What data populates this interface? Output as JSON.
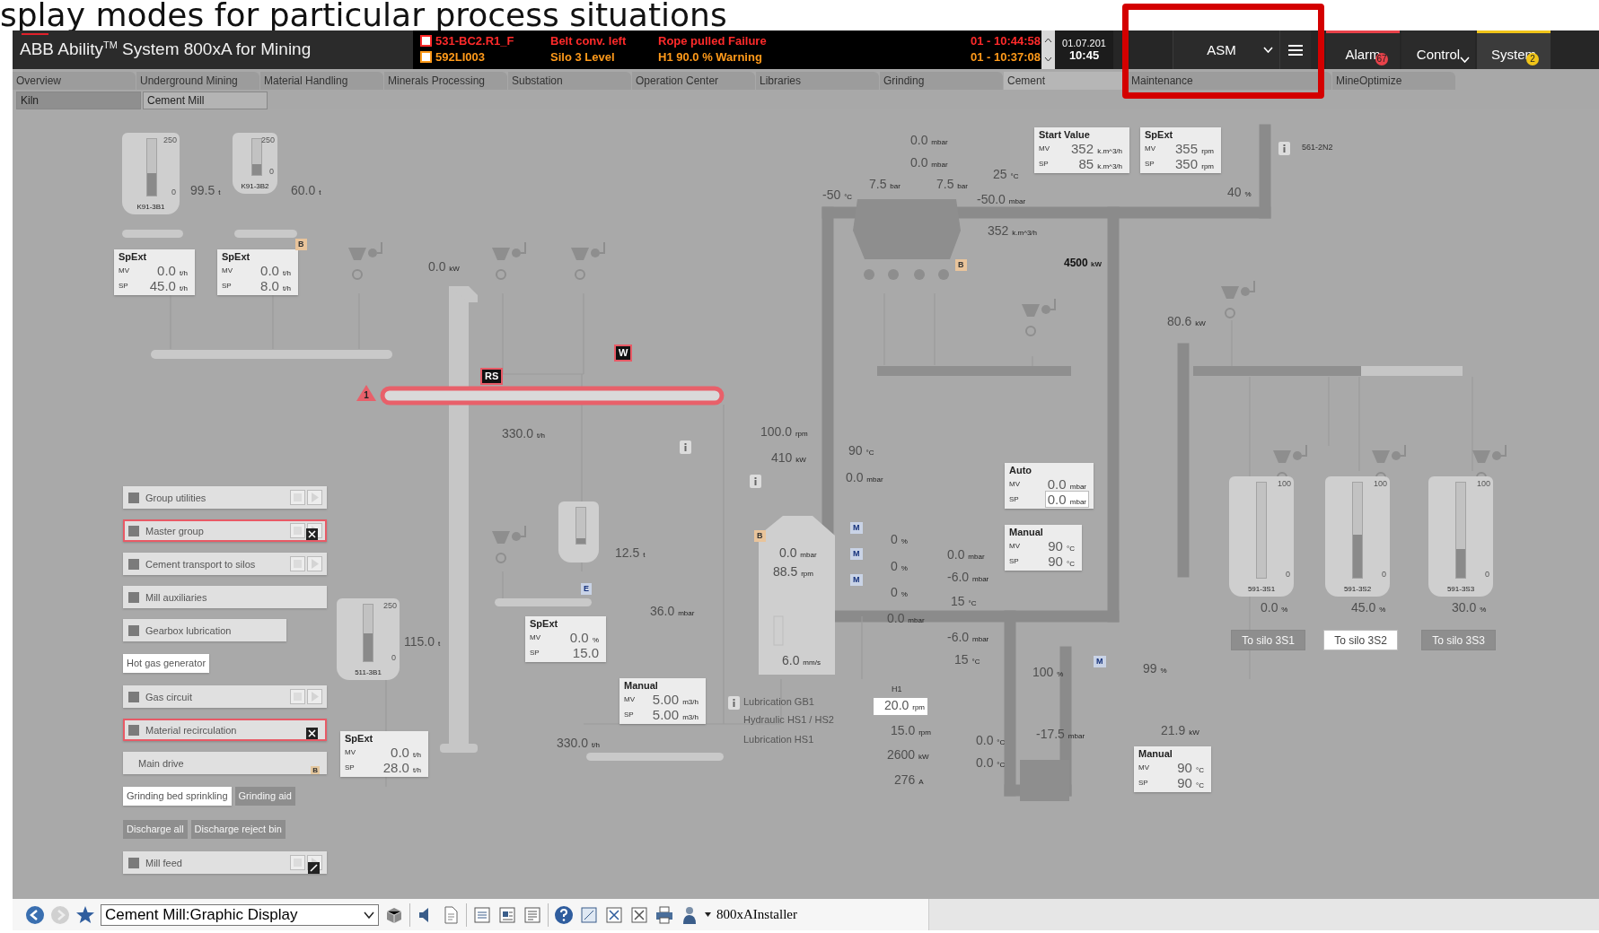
{
  "slide_title": "splay modes for particular process situations",
  "header": {
    "product": "ABB Ability$^{TM}$ System 800xA for Mining",
    "alarms": [
      {
        "tag": "531-BC2.R1_F",
        "object": "Belt conv. left",
        "message": "Rope pulled Failure",
        "time": "01 - 10:44:58",
        "color": "#ff2a2a"
      },
      {
        "tag": "592LI003",
        "object": "Silo 3 Level",
        "message": "H1 90.0 % Warning",
        "time": "01 - 10:37:08",
        "color": "#ff9a1a"
      }
    ],
    "date": "01.07.201",
    "clock": "10:45",
    "mode_selector": "ASM",
    "apps": [
      {
        "label": "Alarm",
        "badge": "67",
        "color": "#e8424a",
        "dropdown": false,
        "selected": false
      },
      {
        "label": "Control",
        "dropdown": true,
        "selected": false
      },
      {
        "label": "System",
        "badge": "2",
        "color": "#f0c419",
        "dropdown": false,
        "selected": true
      }
    ]
  },
  "tabs": [
    {
      "label": "Overview",
      "selected": false
    },
    {
      "label": "Underground Mining",
      "selected": false
    },
    {
      "label": "Material Handling",
      "selected": false
    },
    {
      "label": "Minerals Processing",
      "selected": false
    },
    {
      "label": "Substation",
      "selected": false
    },
    {
      "label": "Operation Center",
      "selected": false
    },
    {
      "label": "Libraries",
      "selected": false
    },
    {
      "label": "Grinding",
      "selected": false
    },
    {
      "label": "Cement",
      "selected": true
    },
    {
      "label": "Maintenance",
      "selected": false
    },
    {
      "label": "MineOptimize",
      "selected": false
    }
  ],
  "subtabs": [
    {
      "label": "Kiln",
      "selected": false
    },
    {
      "label": "Cement Mill",
      "selected": true
    }
  ],
  "faceplates": [
    {
      "title": "SpExt",
      "rows": [
        {
          "label": "MV",
          "value": "0.0",
          "unit": "t/h",
          "editable": false
        },
        {
          "label": "SP",
          "value": "45.0",
          "unit": "t/h",
          "editable": false
        }
      ]
    },
    {
      "title": "SpExt",
      "rows": [
        {
          "label": "MV",
          "value": "0.0",
          "unit": "t/h",
          "editable": false
        },
        {
          "label": "SP",
          "value": "8.0",
          "unit": "t/h",
          "editable": false
        }
      ]
    },
    {
      "title": "Start Value",
      "rows": [
        {
          "label": "MV",
          "value": "352",
          "unit": "k.m^3/h",
          "editable": false
        },
        {
          "label": "SP",
          "value": "85",
          "unit": "k.m^3/h",
          "editable": false
        }
      ]
    },
    {
      "title": "SpExt",
      "rows": [
        {
          "label": "MV",
          "value": "355",
          "unit": "rpm",
          "editable": false
        },
        {
          "label": "SP",
          "value": "350",
          "unit": "rpm",
          "editable": false
        }
      ]
    },
    {
      "title": "Auto",
      "rows": [
        {
          "label": "MV",
          "value": "0.0",
          "unit": "mbar",
          "editable": false
        },
        {
          "label": "SP",
          "value": "0.0",
          "unit": "mbar",
          "editable": true
        }
      ]
    },
    {
      "title": "Manual",
      "rows": [
        {
          "label": "MV",
          "value": "90",
          "unit": "°C",
          "editable": false
        },
        {
          "label": "SP",
          "value": "90",
          "unit": "°C",
          "editable": false
        }
      ]
    },
    {
      "title": "SpExt",
      "rows": [
        {
          "label": "MV",
          "value": "0.0",
          "unit": "%",
          "editable": false
        },
        {
          "label": "SP",
          "value": "15.0",
          "editable": false
        }
      ]
    },
    {
      "title": "Manual",
      "rows": [
        {
          "label": "MV",
          "value": "5.00",
          "unit": "m3/h",
          "editable": false
        },
        {
          "label": "SP",
          "value": "5.00",
          "unit": "m3/h",
          "editable": false
        }
      ]
    },
    {
      "title": "SpExt",
      "rows": [
        {
          "label": "MV",
          "value": "0.0",
          "unit": "t/h",
          "editable": false
        },
        {
          "label": "SP",
          "value": "28.0",
          "unit": "t/h",
          "editable": false
        }
      ]
    },
    {
      "title": "Manual",
      "rows": [
        {
          "label": "MV",
          "value": "90",
          "unit": "°C",
          "editable": false
        },
        {
          "label": "SP",
          "value": "90",
          "unit": "°C",
          "editable": false
        }
      ]
    }
  ],
  "group_panel": {
    "rows": [
      {
        "items": [
          {
            "kind": "group",
            "label": "Group utilities",
            "checkbox": true,
            "controls": true,
            "alarm": false,
            "crossed": false,
            "slashed": false
          }
        ]
      },
      {
        "items": [
          {
            "kind": "group",
            "label": "Master group",
            "checkbox": true,
            "controls": true,
            "alarm": true,
            "crossed": true,
            "slashed": false
          }
        ]
      },
      {
        "items": [
          {
            "kind": "group",
            "label": "Cement transport to silos",
            "checkbox": true,
            "controls": true,
            "alarm": false,
            "crossed": false,
            "slashed": false
          }
        ]
      },
      {
        "items": [
          {
            "kind": "group",
            "label": "Mill auxiliaries",
            "checkbox": true,
            "controls": false,
            "alarm": false,
            "crossed": false,
            "slashed": false
          }
        ]
      },
      {
        "items": [
          {
            "kind": "group",
            "label": "Gearbox lubrication",
            "checkbox": true,
            "controls": false,
            "alarm": false,
            "crossed": false,
            "slashed": false
          }
        ]
      },
      {
        "items": [
          {
            "kind": "link",
            "label": "Hot gas generator",
            "disabled": false
          }
        ]
      },
      {
        "items": [
          {
            "kind": "group",
            "label": "Gas circuit",
            "checkbox": true,
            "controls": true,
            "alarm": false,
            "crossed": false,
            "slashed": false
          }
        ]
      },
      {
        "items": [
          {
            "kind": "group",
            "label": "Material recirculation",
            "checkbox": true,
            "controls": false,
            "alarm": true,
            "crossed": true,
            "slashed": false
          }
        ]
      },
      {
        "items": [
          {
            "kind": "group",
            "label": "Main drive",
            "checkbox": false,
            "controls": false,
            "alarm": false,
            "crossed": false,
            "slashed": false,
            "badge": "B"
          }
        ]
      },
      {
        "items": [
          {
            "kind": "link",
            "label": "Grinding bed sprinkling",
            "disabled": false
          },
          {
            "kind": "link",
            "label": "Grinding aid",
            "disabled": true
          }
        ]
      },
      {
        "items": [
          {
            "kind": "link",
            "label": "Discharge all",
            "disabled": true
          },
          {
            "kind": "link",
            "label": "Discharge reject bin",
            "disabled": true
          }
        ]
      },
      {
        "items": [
          {
            "kind": "group",
            "label": "Mill feed",
            "checkbox": true,
            "controls": true,
            "alarm": false,
            "crossed": false,
            "slashed": true
          }
        ]
      }
    ]
  },
  "silos": [
    {
      "tag": "K91-3B1",
      "scale_max": "250",
      "scale_min": "0",
      "level": 0.4
    },
    {
      "tag": "K91-3B2",
      "scale_max": "250",
      "scale_min": "0",
      "level": 0.3
    },
    {
      "tag": "511-3B1",
      "scale_max": "250",
      "scale_min": "0",
      "level": 0.5
    },
    {
      "level": 0.15
    },
    {
      "tag": "591-3S1",
      "scale_max": "100",
      "scale_min": "0",
      "level": 0.0
    },
    {
      "tag": "591-3S2",
      "scale_max": "100",
      "scale_min": "0",
      "level": 0.45
    },
    {
      "tag": "591-3S3",
      "scale_max": "100",
      "scale_min": "0",
      "level": 0.3
    }
  ],
  "values": [
    {
      "value": "99.5",
      "unit": "t",
      "kind": "faint"
    },
    {
      "value": "60.0",
      "unit": "t",
      "kind": "faint"
    },
    {
      "value": "0.0",
      "unit": "kW",
      "kind": "faint"
    },
    {
      "value": "330.0",
      "unit": "t/h",
      "kind": "faint"
    },
    {
      "value": "100.0",
      "unit": "rpm",
      "kind": "faint"
    },
    {
      "value": "410",
      "unit": "kW",
      "kind": "faint"
    },
    {
      "value": "12.5",
      "unit": "t",
      "kind": "faint"
    },
    {
      "value": "115.0",
      "unit": "t",
      "kind": "faint"
    },
    {
      "value": "36.0",
      "unit": "mbar",
      "kind": "faint"
    },
    {
      "value": "330.0",
      "unit": "t/h",
      "kind": "faint"
    },
    {
      "value": "0.0",
      "unit": "mbar",
      "kind": "faint"
    },
    {
      "value": "0.0",
      "unit": "mbar",
      "kind": "faint"
    },
    {
      "value": "7.5",
      "unit": "bar",
      "kind": "faint"
    },
    {
      "value": "7.5",
      "unit": "bar",
      "kind": "faint"
    },
    {
      "value": "25",
      "unit": "°C",
      "kind": "faint"
    },
    {
      "value": "-50",
      "unit": "°C",
      "kind": "faint"
    },
    {
      "value": "-50.0",
      "unit": "mbar",
      "kind": "faint"
    },
    {
      "value": "352",
      "unit": "k.m^3/h",
      "kind": "faint"
    },
    {
      "value": "40",
      "unit": "%",
      "kind": "faint"
    },
    {
      "value": "4500",
      "unit": "kW",
      "kind": "strong"
    },
    {
      "value": "80.6",
      "unit": "kW",
      "kind": "faint"
    },
    {
      "value": "90",
      "unit": "°C",
      "kind": "faint"
    },
    {
      "value": "0.0",
      "unit": "mbar",
      "kind": "faint"
    },
    {
      "value": "0.0",
      "unit": "mbar",
      "kind": "faint"
    },
    {
      "value": "88.5",
      "unit": "rpm",
      "kind": "faint"
    },
    {
      "value": "0",
      "unit": "%",
      "kind": "faint"
    },
    {
      "value": "0",
      "unit": "%",
      "kind": "faint"
    },
    {
      "value": "0",
      "unit": "%",
      "kind": "faint"
    },
    {
      "value": "0.0",
      "unit": "mbar",
      "kind": "faint"
    },
    {
      "value": "-6.0",
      "unit": "mbar",
      "kind": "faint"
    },
    {
      "value": "15",
      "unit": "°C",
      "kind": "faint"
    },
    {
      "value": "0.0",
      "unit": "mbar",
      "kind": "faint"
    },
    {
      "value": "-6.0",
      "unit": "mbar",
      "kind": "faint"
    },
    {
      "value": "15",
      "unit": "°C",
      "kind": "faint"
    },
    {
      "value": "6.0",
      "unit": "mm/s",
      "kind": "faint"
    },
    {
      "value": "20.0",
      "unit": "rpm",
      "kind": "input"
    },
    {
      "value": "15.0",
      "unit": "rpm",
      "kind": "faint"
    },
    {
      "value": "2600",
      "unit": "kW",
      "kind": "faint"
    },
    {
      "value": "276",
      "unit": "A",
      "kind": "faint"
    },
    {
      "value": "0.0",
      "unit": "°C",
      "kind": "faint"
    },
    {
      "value": "0.0",
      "unit": "°C",
      "kind": "faint"
    },
    {
      "value": "100",
      "unit": "%",
      "kind": "faint"
    },
    {
      "value": "-17.5",
      "unit": "mbar",
      "kind": "faint"
    },
    {
      "value": "99",
      "unit": "%",
      "kind": "faint"
    },
    {
      "value": "21.9",
      "unit": "kW",
      "kind": "faint"
    },
    {
      "value": "0.0",
      "unit": "%",
      "kind": "faint"
    },
    {
      "value": "45.0",
      "unit": "%",
      "kind": "faint"
    },
    {
      "value": "30.0",
      "unit": "%",
      "kind": "faint"
    }
  ],
  "tags": [
    "561-2N2",
    "H1"
  ],
  "labels": [
    "Lubrication GB1",
    "Hydraulic HS1 / HS2",
    "Lubrication HS1"
  ],
  "silo_buttons": [
    {
      "label": "To silo 3S1",
      "enabled": false
    },
    {
      "label": "To silo 3S2",
      "enabled": true
    },
    {
      "label": "To silo 3S3",
      "enabled": false
    }
  ],
  "markers": [
    {
      "text": "RS",
      "kind": "alarm"
    },
    {
      "text": "W",
      "kind": "alarm"
    },
    {
      "text": "1",
      "kind": "priority"
    },
    {
      "text": "B",
      "kind": "bypass"
    },
    {
      "text": "B",
      "kind": "bypass"
    },
    {
      "text": "B",
      "kind": "bypass"
    },
    {
      "text": "E",
      "kind": "mode"
    },
    {
      "text": "M",
      "kind": "mode"
    },
    {
      "text": "M",
      "kind": "mode"
    },
    {
      "text": "M",
      "kind": "mode"
    },
    {
      "text": "M",
      "kind": "mode"
    }
  ],
  "toolbar": {
    "display_selector": "Cement Mill:Graphic Display",
    "user": "800xAInstaller"
  }
}
